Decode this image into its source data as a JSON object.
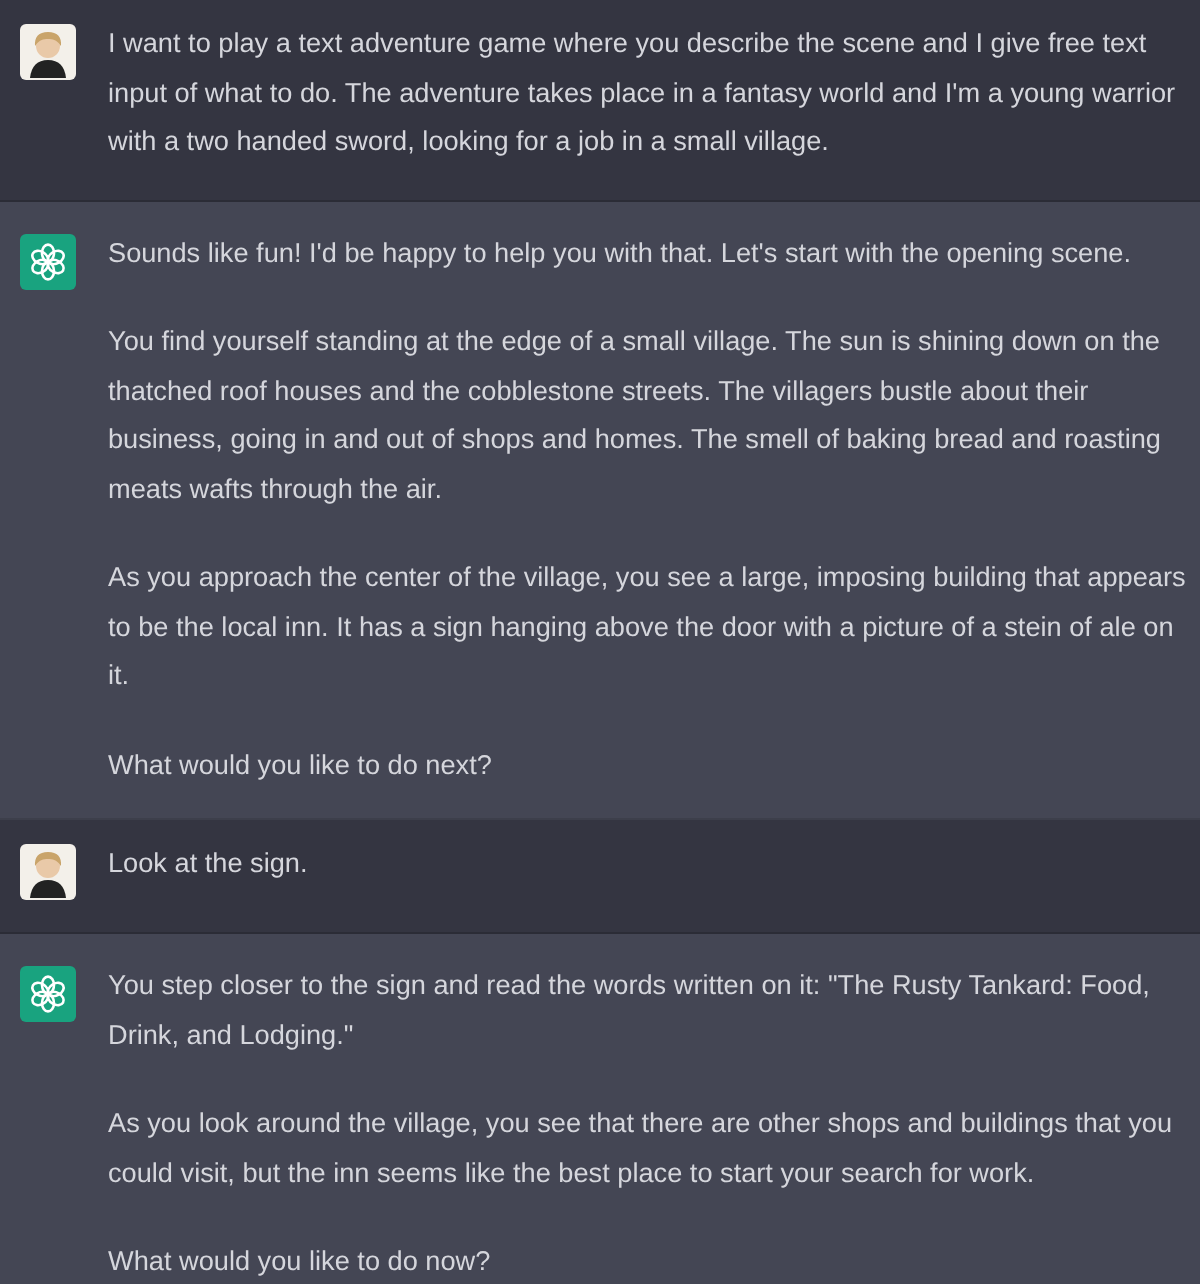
{
  "messages": [
    {
      "kind": "user",
      "paragraphs": [
        "I want to play a text adventure game where you describe the scene and I give free text input of what to do. The adventure takes place in a fantasy world and I'm a young warrior with a two handed sword, looking for a job in a small village."
      ]
    },
    {
      "kind": "assistant",
      "paragraphs": [
        "Sounds like fun! I'd be happy to help you with that. Let's start with the opening scene.",
        "You find yourself standing at the edge of a small village. The sun is shining down on the thatched roof houses and the cobblestone streets. The villagers bustle about their business, going in and out of shops and homes. The smell of baking bread and roasting meats wafts through the air.",
        "As you approach the center of the village, you see a large, imposing building that appears to be the local inn. It has a sign hanging above the door with a picture of a stein of ale on it.",
        "What would you like to do next?"
      ]
    },
    {
      "kind": "user",
      "paragraphs": [
        "Look at the sign."
      ]
    },
    {
      "kind": "assistant",
      "paragraphs": [
        "You step closer to the sign and read the words written on it: \"The Rusty Tankard: Food, Drink, and Lodging.\"",
        "As you look around the village, you see that there are other shops and buildings that you could visit, but the inn seems like the best place to start your search for work.",
        "What would you like to do now?"
      ]
    }
  ]
}
